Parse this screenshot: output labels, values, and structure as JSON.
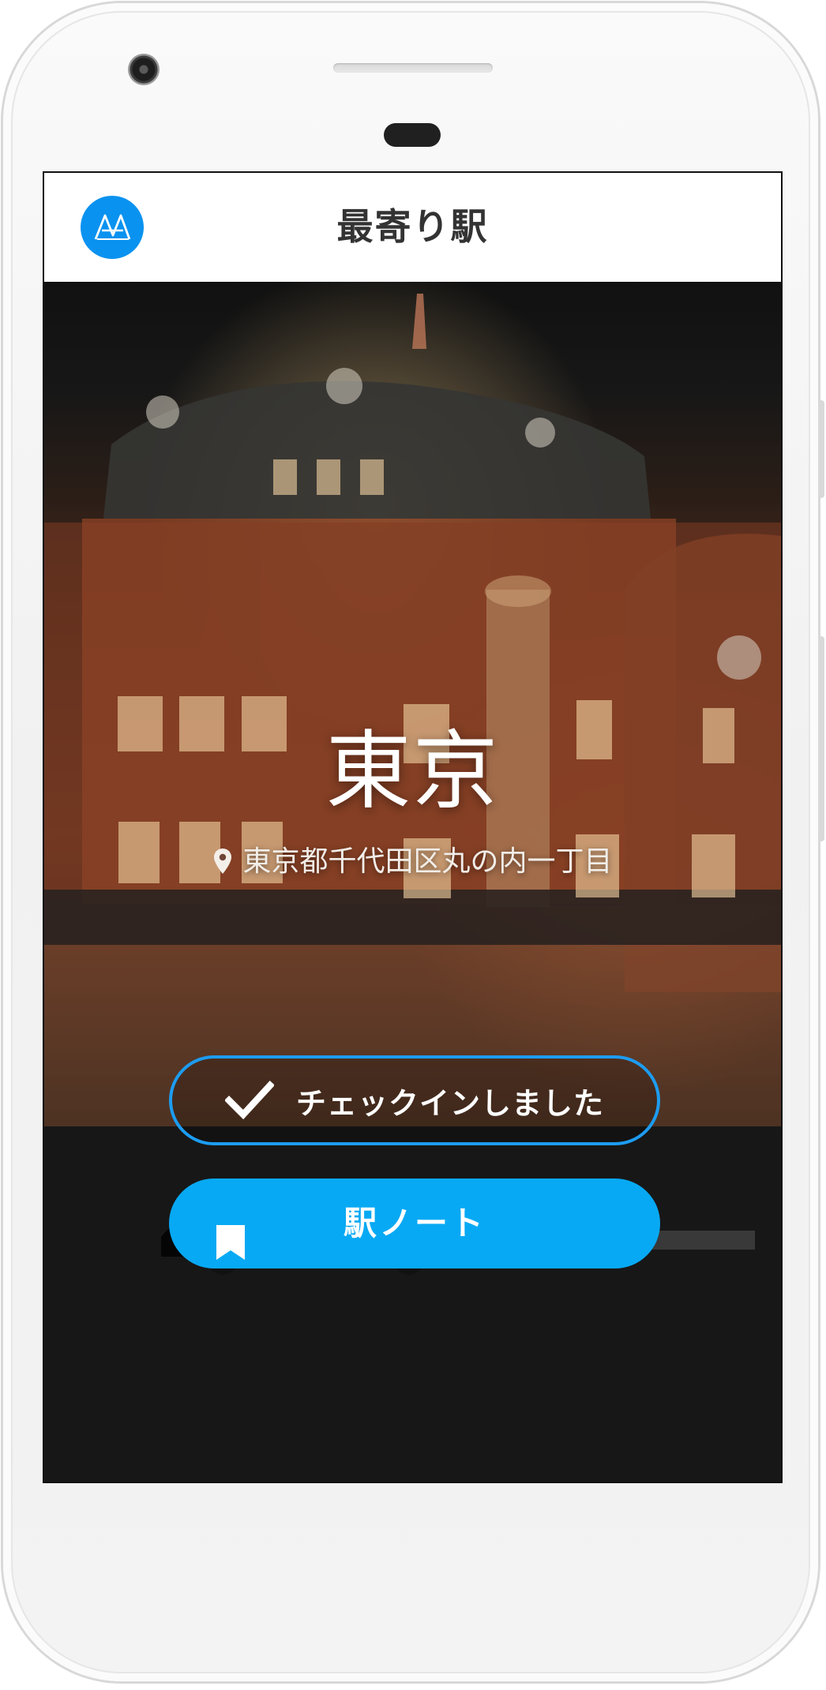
{
  "app": {
    "title": "最寄り駅",
    "logo_icon": "railway-logo-icon"
  },
  "station": {
    "name": "東京",
    "address": "東京都千代田区丸の内一丁目"
  },
  "actions": {
    "checkin_label": "チェックインしました",
    "note_label": "駅ノート"
  },
  "colors": {
    "accent": "#0A92F0",
    "button_blue": "#08A9F4",
    "border_blue": "#1D9CF0"
  }
}
